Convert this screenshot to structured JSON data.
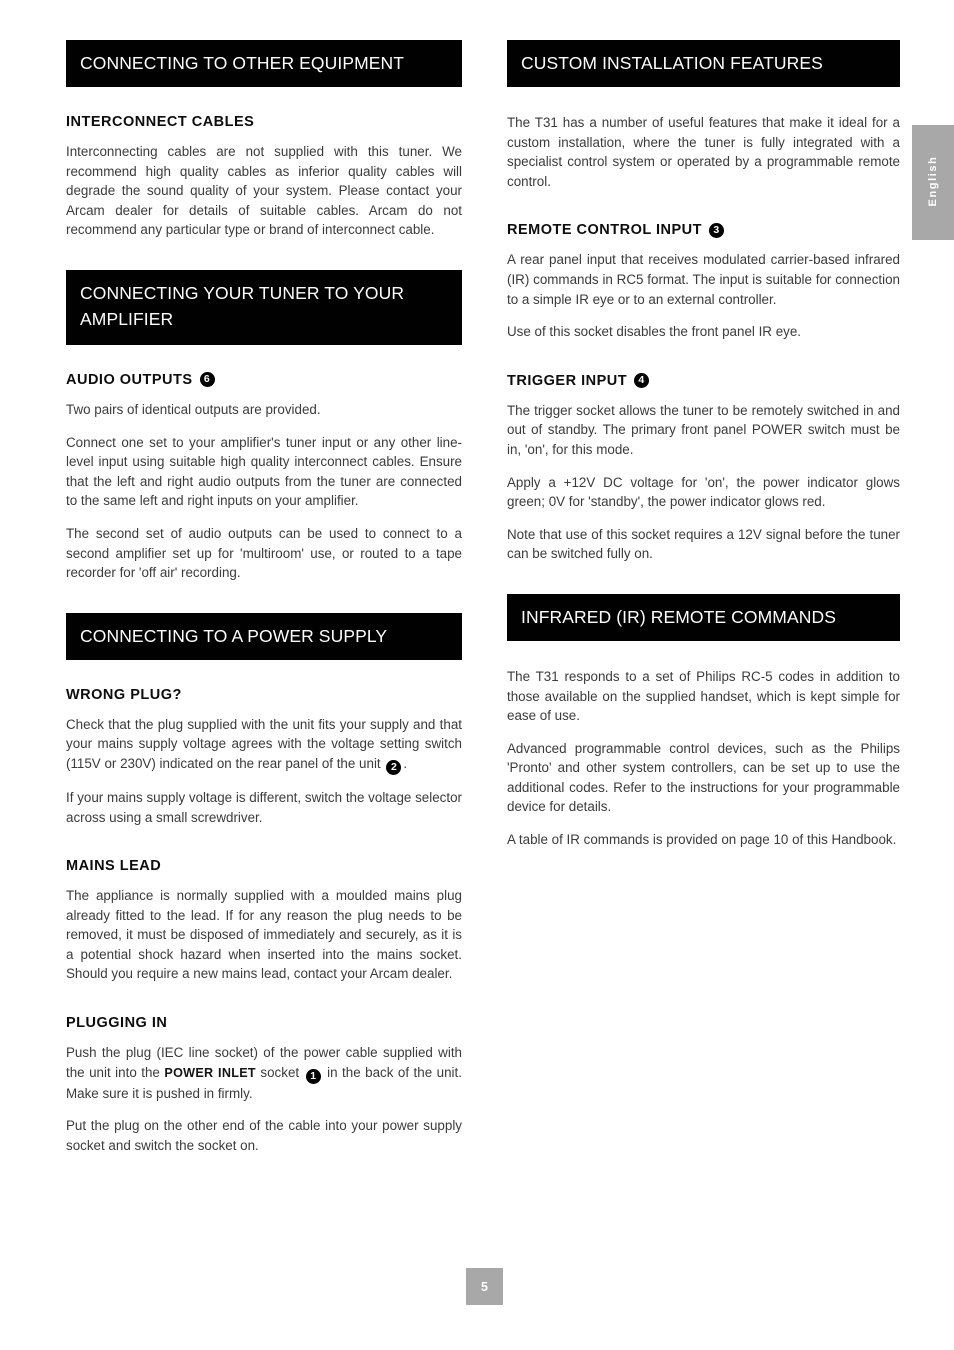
{
  "page": {
    "number": "5",
    "language_tab": "English"
  },
  "left_column": {
    "section_connecting_other_equipment": {
      "banner": "CONNECTING TO OTHER EQUIPMENT",
      "interconnect_cables": {
        "heading": "INTERCONNECT CABLES",
        "paragraph_1": "Interconnecting cables are not supplied with this tuner. We recommend high quality cables as inferior quality cables will degrade the sound quality of your system. Please contact your Arcam dealer for details of suitable cables. Arcam do not recommend any particular type or brand of interconnect cable."
      }
    },
    "section_connecting_tuner_amplifier": {
      "banner_line_1": "CONNECTING YOUR TUNER TO YOUR",
      "banner_line_2": "AMPLIFIER",
      "audio_outputs": {
        "heading": "AUDIO OUTPUTS",
        "callout_number": "6",
        "paragraph_1": "Two pairs of identical outputs are provided.",
        "paragraph_2": "Connect one set to your amplifier's tuner input or any other line-level input using suitable high quality interconnect cables. Ensure that the left and right audio outputs from the tuner are connected to the same left and right inputs on your amplifier.",
        "paragraph_3": "The second set of audio outputs can be used to connect to a second amplifier set up for 'multiroom' use, or routed to a tape recorder for 'off air' recording."
      }
    },
    "section_connecting_power_supply": {
      "banner": "CONNECTING TO A POWER SUPPLY",
      "wrong_plug": {
        "heading": "WRONG PLUG?",
        "paragraph_1_before": "Check that the plug supplied with the unit fits your supply and that your mains supply voltage agrees with the voltage setting switch (115V or 230V) indicated on the rear panel of the unit",
        "paragraph_1_callout": "2",
        "paragraph_1_after": ".",
        "paragraph_2": "If your mains supply voltage is different, switch the voltage selector across using a small screwdriver."
      },
      "mains_lead": {
        "heading": "MAINS LEAD",
        "paragraph_1": "The appliance is normally supplied with a moulded mains plug already fitted to the lead. If for any reason the plug needs to be removed, it must be disposed of immediately and securely, as it is a potential shock hazard when inserted into the mains socket. Should you require a new mains lead, contact your Arcam dealer."
      },
      "plugging_in": {
        "heading": "PLUGGING IN",
        "paragraph_1_part_1": "Push the plug (IEC line socket) of the power cable supplied with the unit into the",
        "paragraph_1_bold": "POWER INLET",
        "paragraph_1_part_2": "socket",
        "paragraph_1_callout": "1",
        "paragraph_1_part_3": "in the back of the unit. Make sure it is pushed in firmly.",
        "paragraph_2": "Put the plug on the other end of the cable into your power supply socket and switch the socket on."
      }
    }
  },
  "right_column": {
    "section_custom_installation": {
      "banner": "CUSTOM INSTALLATION FEATURES",
      "intro_paragraph": "The T31 has a number of useful features that make it ideal for a custom installation, where the tuner is fully integrated with a specialist control system or operated by a programmable remote control.",
      "remote_control_input": {
        "heading": "REMOTE CONTROL INPUT",
        "callout_number": "3",
        "paragraph_1": "A rear panel input that receives modulated carrier-based infrared (IR) commands in RC5 format. The input is suitable for connection to a simple IR eye or to an external controller.",
        "paragraph_2": "Use of this socket disables the front panel IR eye."
      },
      "trigger_input": {
        "heading": "TRIGGER INPUT",
        "callout_number": "4",
        "paragraph_1": "The trigger socket allows the tuner to be remotely switched in and out of standby. The primary front panel POWER switch must be in, 'on', for this mode.",
        "paragraph_2": "Apply a +12V DC voltage for 'on', the power indicator glows green; 0V for 'standby', the power indicator glows red.",
        "paragraph_3": "Note that use of this socket requires a 12V signal before the tuner can be switched fully on."
      }
    },
    "section_infrared_remote_commands": {
      "banner": "INFRARED (IR) REMOTE COMMANDS",
      "paragraph_1": "The T31 responds to a set of Philips RC-5 codes in addition to those available on the supplied handset, which is kept simple for ease of use.",
      "paragraph_2": "Advanced programmable control devices, such as the Philips 'Pronto' and other system controllers, can be set up to use the additional codes. Refer to the instructions for your programmable device for details.",
      "paragraph_3": "A table of IR commands is provided on page 10 of this Handbook."
    }
  },
  "colors": {
    "banner_background": "#010101",
    "banner_text": "#ffffff",
    "heading_text": "#0d0d0d",
    "body_text": "#3b3b3b",
    "tab_background": "#a8a8a8",
    "page_background": "#ffffff"
  }
}
